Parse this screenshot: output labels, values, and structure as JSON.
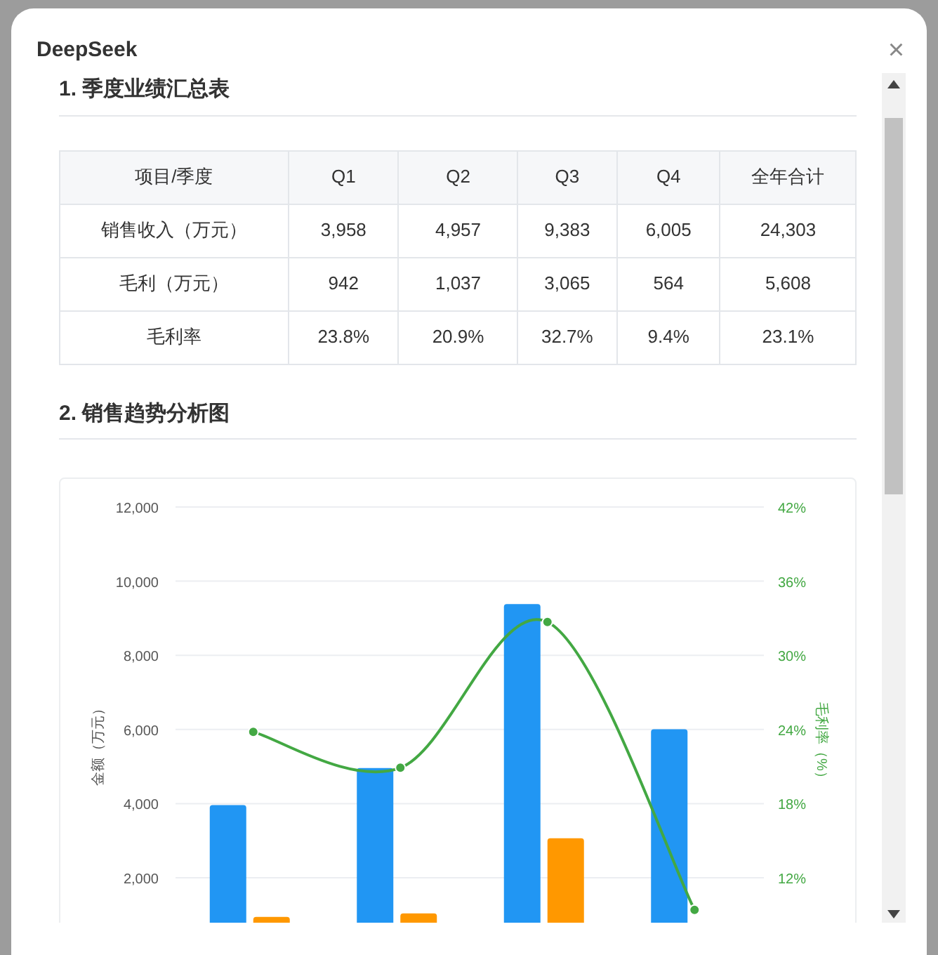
{
  "dialog": {
    "title": "DeepSeek",
    "close": "×"
  },
  "sections": [
    {
      "heading": "1. 季度业绩汇总表"
    },
    {
      "heading": "2. 销售趋势分析图"
    }
  ],
  "table": {
    "columns": [
      "项目/季度",
      "Q1",
      "Q2",
      "Q3",
      "Q4",
      "全年合计"
    ],
    "rows": [
      [
        "销售收入（万元）",
        "3,958",
        "4,957",
        "9,383",
        "6,005",
        "24,303"
      ],
      [
        "毛利（万元）",
        "942",
        "1,037",
        "3,065",
        "564",
        "5,608"
      ],
      [
        "毛利率",
        "23.8%",
        "20.9%",
        "32.7%",
        "9.4%",
        "23.1%"
      ]
    ]
  },
  "chart_data": {
    "type": "bar",
    "ylabel": "金额（万元）",
    "y2label": "毛利率（%）",
    "ylim": [
      0,
      12000
    ],
    "y2lim": [
      6,
      42
    ],
    "yticks": [
      {
        "value": 2000,
        "label": "2,000"
      },
      {
        "value": 4000,
        "label": "4,000"
      },
      {
        "value": 6000,
        "label": "6,000"
      },
      {
        "value": 8000,
        "label": "8,000"
      },
      {
        "value": 10000,
        "label": "10,000"
      },
      {
        "value": 12000,
        "label": "12,000"
      }
    ],
    "y2ticks": [
      {
        "value": 12,
        "label": "12%"
      },
      {
        "value": 18,
        "label": "18%"
      },
      {
        "value": 24,
        "label": "24%"
      },
      {
        "value": 30,
        "label": "30%"
      },
      {
        "value": 36,
        "label": "36%"
      },
      {
        "value": 42,
        "label": "42%"
      }
    ],
    "grid": true,
    "series": [
      {
        "type": "bar",
        "color": "#2196f3",
        "values": [
          3958,
          4957,
          9383,
          6005
        ]
      },
      {
        "type": "bar",
        "color": "#ff9800",
        "values": [
          942,
          1037,
          3065,
          null
        ]
      },
      {
        "type": "line",
        "axis": "y2",
        "marker": "circle",
        "color": "#43a843",
        "values": [
          23.8,
          20.9,
          32.7,
          9.4
        ]
      }
    ]
  }
}
